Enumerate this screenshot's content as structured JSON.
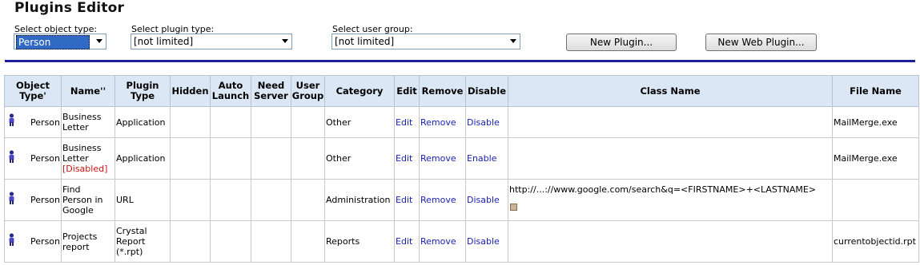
{
  "page": {
    "title": "Plugins Editor"
  },
  "filters": {
    "object_type": {
      "label": "Select object type:",
      "value": "Person"
    },
    "plugin_type": {
      "label": "Select plugin type:",
      "value": "[not limited]"
    },
    "user_group": {
      "label": "Select user group:",
      "value": "[not limited]"
    }
  },
  "buttons": {
    "new_plugin": "New Plugin...",
    "new_web_plugin": "New Web Plugin..."
  },
  "table": {
    "headers": {
      "object_type": [
        "Object",
        "Type'"
      ],
      "name": "Name''",
      "plugin_type": [
        "Plugin",
        "Type"
      ],
      "hidden": "Hidden",
      "auto_launch": [
        "Auto",
        "Launch"
      ],
      "need_server": [
        "Need",
        "Server"
      ],
      "user_group": [
        "User",
        "Group"
      ],
      "category": "Category",
      "edit": "Edit",
      "remove": "Remove",
      "disable": "Disable",
      "class_name": "Class Name",
      "file_name": "File Name"
    },
    "rows": [
      {
        "object_type": "Person",
        "name": [
          "Business",
          "Letter"
        ],
        "plugin_type": [
          "Application"
        ],
        "category": "Other",
        "edit": "Edit",
        "remove": "Remove",
        "toggle": "Disable",
        "class_name": "",
        "file_name": "MailMerge.exe"
      },
      {
        "object_type": "Person",
        "name": [
          "Business",
          "Letter"
        ],
        "name_status": "[Disabled]",
        "plugin_type": [
          "Application"
        ],
        "category": "Other",
        "edit": "Edit",
        "remove": "Remove",
        "toggle": "Enable",
        "class_name": "",
        "file_name": "MailMerge.exe"
      },
      {
        "object_type": "Person",
        "name": [
          "Find",
          "Person in",
          "Google"
        ],
        "plugin_type": [
          "URL"
        ],
        "category": "Administration",
        "edit": "Edit",
        "remove": "Remove",
        "toggle": "Disable",
        "class_name": "http://...://www.google.com/search&q=<FIRSTNAME>+<LASTNAME>",
        "file_name": ""
      },
      {
        "object_type": "Person",
        "name": [
          "Projects",
          "report"
        ],
        "plugin_type": [
          "Crystal",
          "Report",
          "(*.rpt)"
        ],
        "category": "Reports",
        "edit": "Edit",
        "remove": "Remove",
        "toggle": "Disable",
        "class_name": "",
        "file_name": "currentobjectid.rpt"
      }
    ]
  },
  "colors": {
    "header_bg": "#dbe7f5",
    "rule": "#1c1c9c",
    "link": "#1a22b0",
    "disabled": "#d01010",
    "selection": "#316ac5"
  }
}
